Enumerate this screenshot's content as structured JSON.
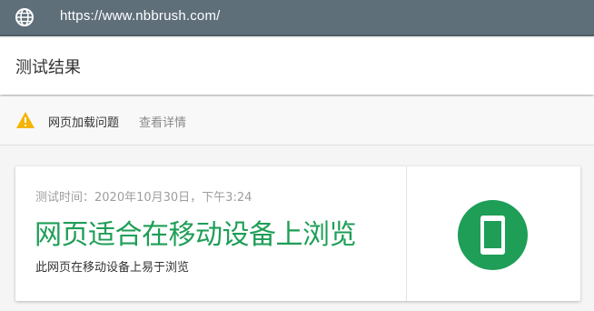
{
  "browser": {
    "url": "https://www.nbbrush.com/"
  },
  "header": {
    "title": "测试结果"
  },
  "issue": {
    "icon": "warning-icon",
    "text": "网页加载问题",
    "link_label": "查看详情",
    "icon_color": "#f4b400"
  },
  "result": {
    "test_time": "测试时间：2020年10月30日，下午3:24",
    "title": "网页适合在移动设备上浏览",
    "subtitle": "此网页在移动设备上易于浏览",
    "accent_color": "#1e9e57",
    "badge_icon": "mobile-phone-icon"
  }
}
